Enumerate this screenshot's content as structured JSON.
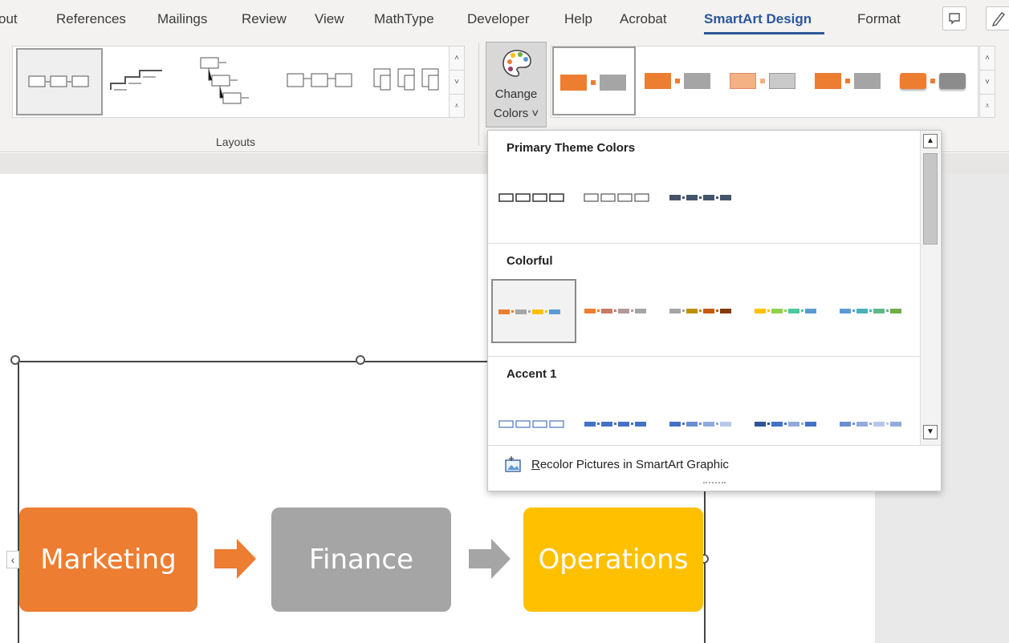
{
  "tabs": [
    {
      "label": "out"
    },
    {
      "label": "References"
    },
    {
      "label": "Mailings"
    },
    {
      "label": "Review"
    },
    {
      "label": "View"
    },
    {
      "label": "MathType"
    },
    {
      "label": "Developer"
    },
    {
      "label": "Help"
    },
    {
      "label": "Acrobat"
    },
    {
      "label": "SmartArt Design",
      "active": true
    },
    {
      "label": "Format"
    }
  ],
  "ribbon": {
    "layouts_group_label": "Layouts",
    "change_colors_line1": "Change",
    "change_colors_line2": "Colors ˅"
  },
  "dropdown": {
    "primary_header": "Primary Theme Colors",
    "colorful_header": "Colorful",
    "accent1_header": "Accent 1",
    "recolor_prefix": "",
    "recolor_underlined": "R",
    "recolor_rest": "ecolor Pictures in SmartArt Graphic"
  },
  "shapes": [
    {
      "label": "Marketing",
      "color": "#ed7d31"
    },
    {
      "label": "Finance",
      "color": "#a5a5a5"
    },
    {
      "label": "Operations",
      "color": "#ffc000"
    }
  ],
  "colors": {
    "accent": "#2b579a",
    "orange": "#ed7d31",
    "gray": "#a5a5a5",
    "gold": "#ffc000",
    "blue": "#5b9bd5",
    "green": "#70ad47",
    "dark": "#44546a"
  }
}
